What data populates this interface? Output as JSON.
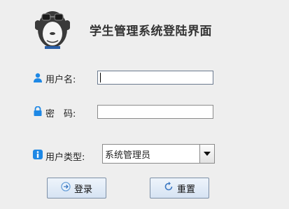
{
  "title": "学生管理系统登陆界面",
  "logo_icon": "monkey-mascot-icon",
  "username": {
    "icon": "user-icon",
    "label": "用户名:",
    "value": ""
  },
  "password": {
    "icon": "lock-icon",
    "label": "密　码:",
    "value": ""
  },
  "user_type": {
    "icon": "info-icon",
    "label": "用户类型:",
    "selected": "系统管理员",
    "arrow_icon": "triangle-down-icon"
  },
  "buttons": {
    "login": {
      "label": "登录",
      "icon": "circle-arrow-right-icon"
    },
    "reset": {
      "label": "重置",
      "icon": "refresh-icon"
    }
  },
  "colors": {
    "accent_blue": "#1e88e5",
    "background": "#eeeeee"
  }
}
